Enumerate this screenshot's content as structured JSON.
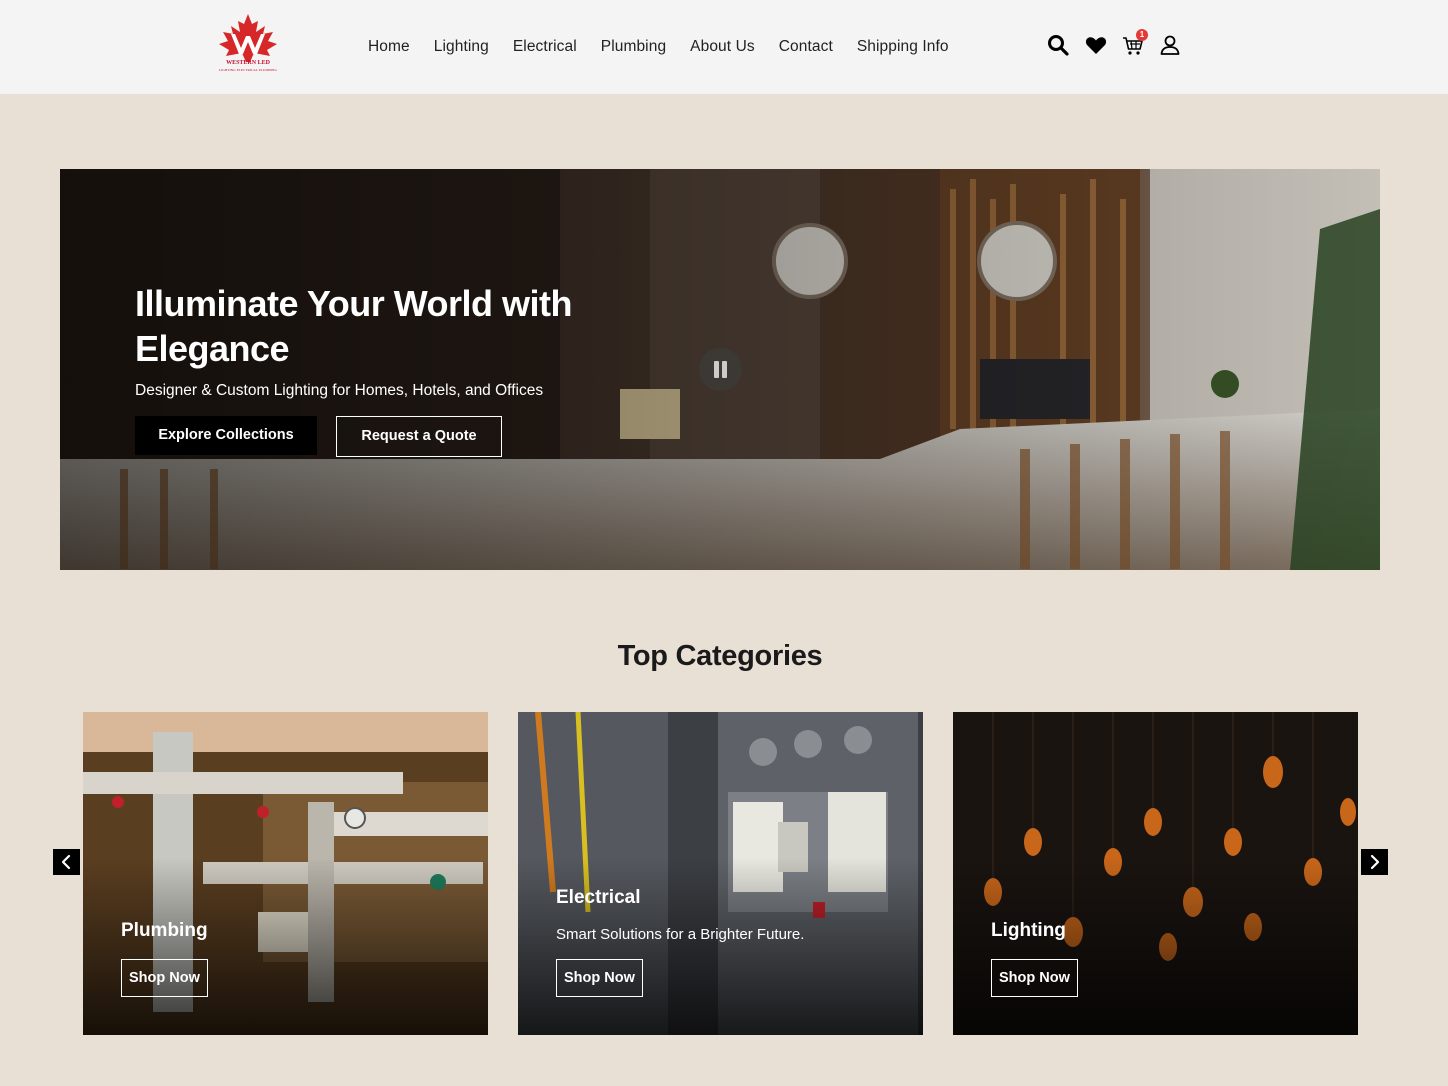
{
  "header": {
    "logo": {
      "brand": "WESTERN LED",
      "tagline": "LIGHTING ELECTRICAL PLUMBING"
    },
    "nav": [
      "Home",
      "Lighting",
      "Electrical",
      "Plumbing",
      "About Us",
      "Contact",
      "Shipping Info"
    ],
    "icons": [
      "search-icon",
      "heart-icon",
      "cart-icon",
      "user-icon"
    ],
    "cart_count": "1"
  },
  "hero": {
    "title": "Illuminate Your World with Elegance",
    "subtitle": "Designer & Custom Lighting for Homes, Hotels, and Offices",
    "primary_button": "Explore Collections",
    "secondary_button": "Request a Quote"
  },
  "categories": {
    "title": "Top Categories",
    "items": [
      {
        "name": "Plumbing",
        "description": "",
        "button": "Shop Now"
      },
      {
        "name": "Electrical",
        "description": "Smart Solutions for a Brighter Future.",
        "button": "Shop Now"
      },
      {
        "name": "Lighting",
        "description": "",
        "button": "Shop Now"
      }
    ]
  },
  "colors": {
    "background": "#e8e0d4",
    "header": "#f4f4f4",
    "accent": "#c8102e",
    "button": "#000000"
  }
}
